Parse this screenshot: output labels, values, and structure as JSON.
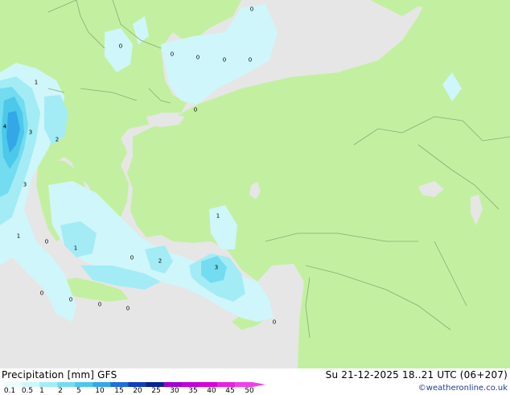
{
  "colors": {
    "sea": "#e6e6e6",
    "land": "#c3f0a0",
    "border": "#8aa878",
    "precip_light": "#cff6fa",
    "precip_1": "#a3ecf6",
    "precip_2": "#74dcf0",
    "precip_5": "#4cc8ea",
    "precip_10": "#34a8e6",
    "credit_text": "#1f3f8f"
  },
  "map": {
    "labels": [
      "0",
      "0",
      "0",
      "0",
      "0",
      "0",
      "0",
      "1",
      "4",
      "3",
      "2",
      "3",
      "1",
      "0",
      "1",
      "0",
      "1",
      "2",
      "3",
      "0",
      "0",
      "0",
      "0",
      "0"
    ]
  },
  "footer": {
    "title": "Precipitation [mm] GFS",
    "run_info": "Su 21-12-2025 18..21 UTC (06+207)",
    "credit": "©weatheronline.co.uk"
  },
  "legend": {
    "ticks": [
      "0.1",
      "0.5",
      "1",
      "2",
      "5",
      "10",
      "15",
      "20",
      "25",
      "30",
      "35",
      "40",
      "45",
      "50"
    ],
    "colors": [
      "#eafcfc",
      "#cff6fa",
      "#a3ecf6",
      "#74dcf0",
      "#4cc8ea",
      "#34a8e6",
      "#2070d8",
      "#1040b8",
      "#082490",
      "#a000d0",
      "#c000d8",
      "#d800d8",
      "#e820e0",
      "#f040e8"
    ]
  }
}
